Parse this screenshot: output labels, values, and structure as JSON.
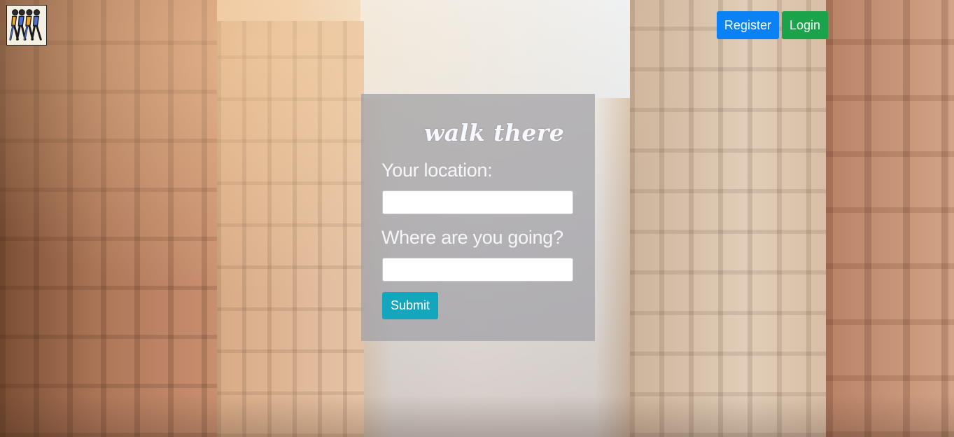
{
  "app": {
    "logo_alt": "walking people logo"
  },
  "nav": {
    "register_label": "Register",
    "login_label": "Login"
  },
  "form": {
    "brand": "walk there",
    "location_label": "Your location:",
    "location_value": "",
    "destination_label": "Where are you going?",
    "destination_value": "",
    "submit_label": "Submit"
  },
  "colors": {
    "register": "#0a82f5",
    "login": "#1aa34a",
    "submit": "#14a6bc"
  },
  "icons": {
    "logo": "walking-people-icon"
  }
}
